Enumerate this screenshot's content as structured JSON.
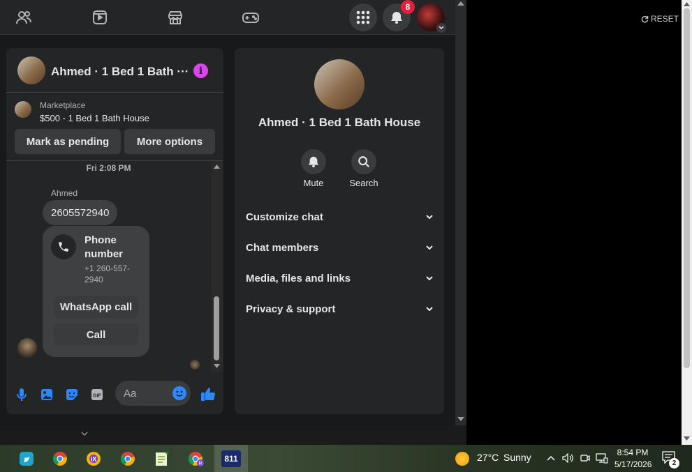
{
  "topbar": {
    "nav_icons": [
      "friends-icon",
      "watch-icon",
      "marketplace-icon",
      "gaming-icon"
    ],
    "notification_count": "8"
  },
  "chat": {
    "header_title": "Ahmed · 1 Bed 1 Bath ···",
    "listing_label": "Marketplace",
    "listing_title": "$500 - 1 Bed 1 Bath House",
    "mark_pending": "Mark as pending",
    "more_options": "More options",
    "timestamp": "Fri 2:08 PM",
    "sender": "Ahmed",
    "message": "2605572940",
    "phone_card_title": "Phone number",
    "phone_card_number": "+1 260-557-2940",
    "whatsapp_call": "WhatsApp call",
    "call": "Call",
    "composer_placeholder": "Aa"
  },
  "info": {
    "name": "Ahmed · 1 Bed 1 Bath House",
    "mute": "Mute",
    "search": "Search",
    "rows": [
      "Customize chat",
      "Chat members",
      "Media, files and links",
      "Privacy & support"
    ]
  },
  "right": {
    "reset": "RESET"
  },
  "taskbar": {
    "weather_temp": "27°C",
    "weather_text": "Sunny",
    "time": "8:54 PM",
    "date": "5/17/2026",
    "notif_count": "2",
    "app_811": "811"
  },
  "colors": {
    "accent_blue": "#2d88ff",
    "info_purple": "#d946ef",
    "badge_red": "#e41e3f"
  }
}
